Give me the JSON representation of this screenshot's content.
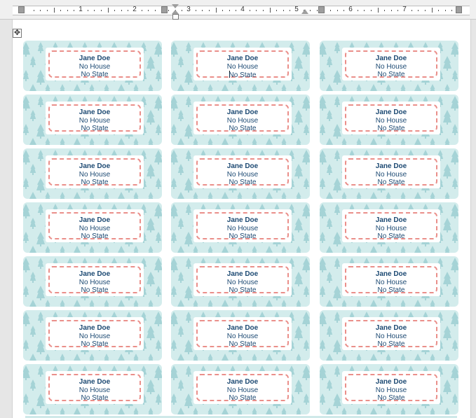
{
  "ruler": {
    "numbers": [
      "1",
      "2",
      "3",
      "4",
      "5",
      "6",
      "7"
    ]
  },
  "label": {
    "name": "Jane Doe",
    "line2": "No House",
    "line3": "No State"
  },
  "grid": {
    "rows": 7,
    "cols": 3
  },
  "colors": {
    "label_bg": "#d3ecec",
    "tree": "#9ccfd2",
    "dash": "#ea8f8a",
    "text": "#1d4a73"
  }
}
